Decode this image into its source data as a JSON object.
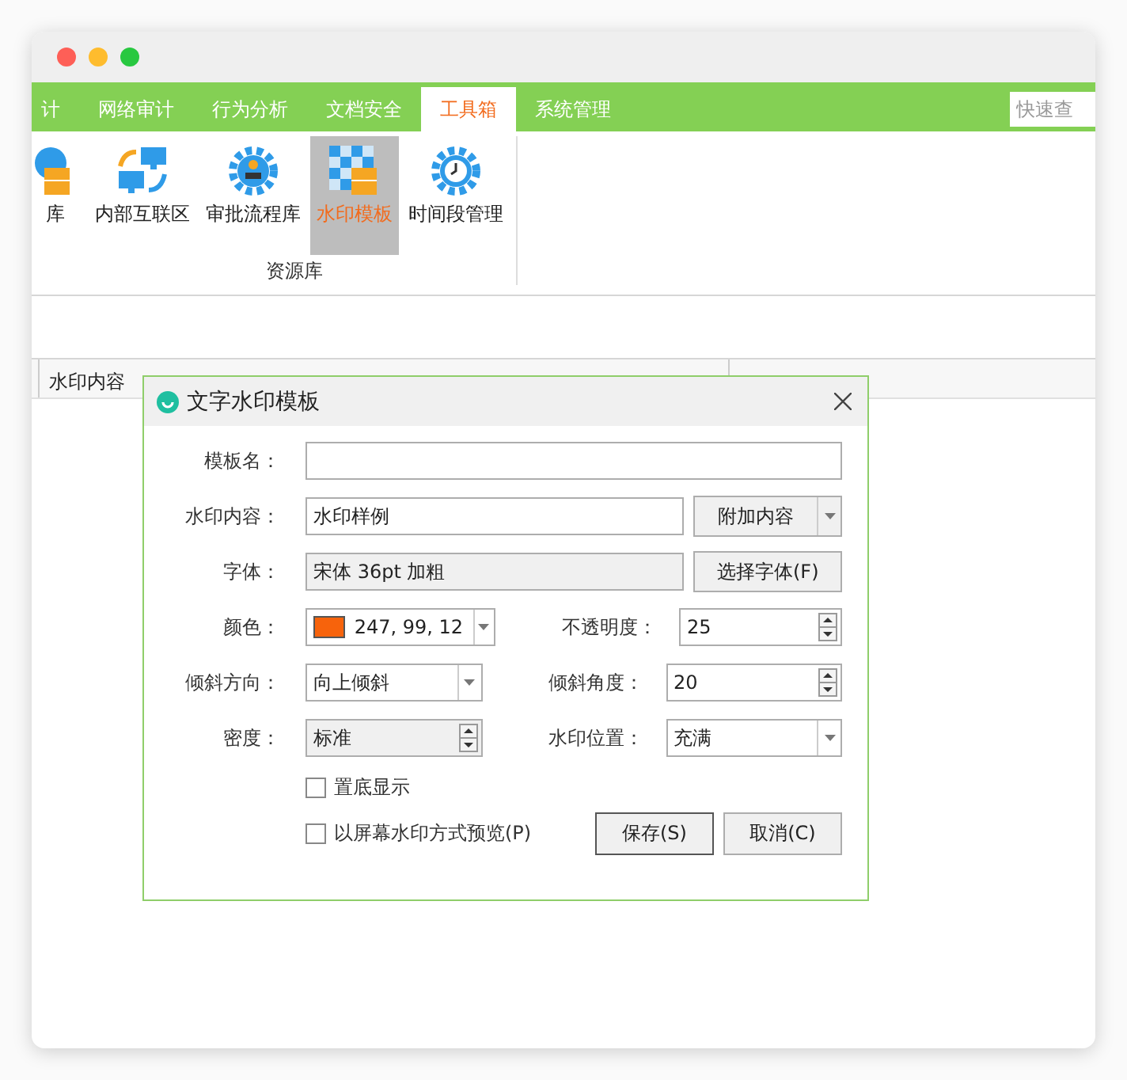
{
  "window": {
    "traffic_lights": [
      {
        "color": "#fe5f57"
      },
      {
        "color": "#febc2e"
      },
      {
        "color": "#28c840"
      }
    ]
  },
  "tabs": [
    {
      "label": "计",
      "selected": false
    },
    {
      "label": "网络审计",
      "selected": false
    },
    {
      "label": "行为分析",
      "selected": false
    },
    {
      "label": "文档安全",
      "selected": false
    },
    {
      "label": "工具箱",
      "selected": true
    },
    {
      "label": "系统管理",
      "selected": false
    }
  ],
  "search": {
    "placeholder": "快速查"
  },
  "ribbon": {
    "items": [
      {
        "label": "库",
        "kind": "cabinet",
        "selected": false
      },
      {
        "label": "内部互联区",
        "kind": "network",
        "selected": false
      },
      {
        "label": "审批流程库",
        "kind": "approval",
        "selected": false
      },
      {
        "label": "水印模板",
        "kind": "watermark",
        "selected": true
      },
      {
        "label": "时间段管理",
        "kind": "clock",
        "selected": false
      }
    ],
    "group_label": "资源库"
  },
  "table": {
    "columns": [
      "水印内容"
    ]
  },
  "dialog": {
    "title": "文字水印模板",
    "template_name": {
      "label": "模板名："
    },
    "content": {
      "label": "水印内容：",
      "value": "水印样例",
      "button": "附加内容"
    },
    "font": {
      "label": "字体：",
      "value": "宋体 36pt 加粗",
      "button": "选择字体(F)"
    },
    "color": {
      "label": "颜色：",
      "value": "247, 99, 12",
      "color": "#f7630c"
    },
    "opacity": {
      "label": "不透明度：",
      "value": "25"
    },
    "tilt_direction": {
      "label": "倾斜方向：",
      "value": "向上倾斜"
    },
    "tilt_angle": {
      "label": "倾斜角度：",
      "value": "20"
    },
    "density": {
      "label": "密度：",
      "value": "标准"
    },
    "position": {
      "label": "水印位置：",
      "value": "充满"
    },
    "checkboxes": [
      {
        "label": "置底显示",
        "checked": false
      },
      {
        "label": "以屏幕水印方式预览(P)",
        "checked": false
      }
    ],
    "buttons": [
      {
        "label": "保存(S)",
        "default": true
      },
      {
        "label": "取消(C)",
        "default": false
      }
    ]
  }
}
